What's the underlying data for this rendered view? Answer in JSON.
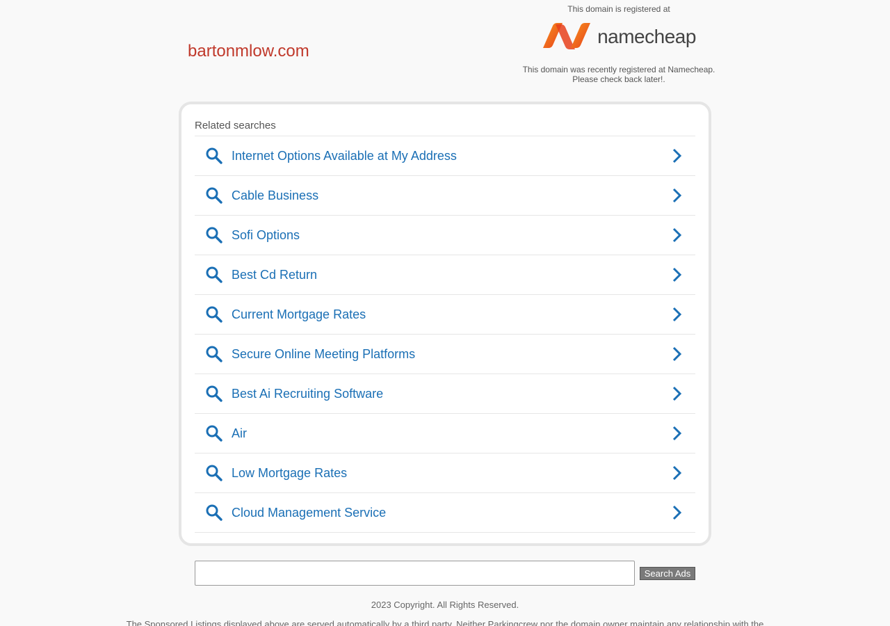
{
  "header": {
    "domain_name": "bartonmlow.com",
    "registered_at_text": "This domain is registered at",
    "registrar_name": "namecheap",
    "notice_line1": "This domain was recently registered at Namecheap.",
    "notice_line2": "Please check back later!."
  },
  "related": {
    "title": "Related searches",
    "items": [
      {
        "label": "Internet Options Available at My Address"
      },
      {
        "label": "Cable Business"
      },
      {
        "label": "Sofi Options"
      },
      {
        "label": "Best Cd Return"
      },
      {
        "label": "Current Mortgage Rates"
      },
      {
        "label": "Secure Online Meeting Platforms"
      },
      {
        "label": "Best Ai Recruiting Software"
      },
      {
        "label": "Air"
      },
      {
        "label": "Low Mortgage Rates"
      },
      {
        "label": "Cloud Management Service"
      }
    ]
  },
  "search": {
    "input_value": "",
    "button_label": "Search Ads"
  },
  "footer": {
    "copyright": "2023 Copyright. All Rights Reserved.",
    "disclaimer": "The Sponsored Listings displayed above are served automatically by a third party. Neither Parkingcrew nor the domain owner maintain any relationship with the"
  },
  "colors": {
    "domain_accent": "#c0392b",
    "link_blue": "#1a6fb5",
    "namecheap_orange": "#f15a22"
  },
  "icons": {
    "item_leading": "search-icon",
    "item_trailing": "chevron-right-icon",
    "brand": "namecheap-logo-icon"
  }
}
